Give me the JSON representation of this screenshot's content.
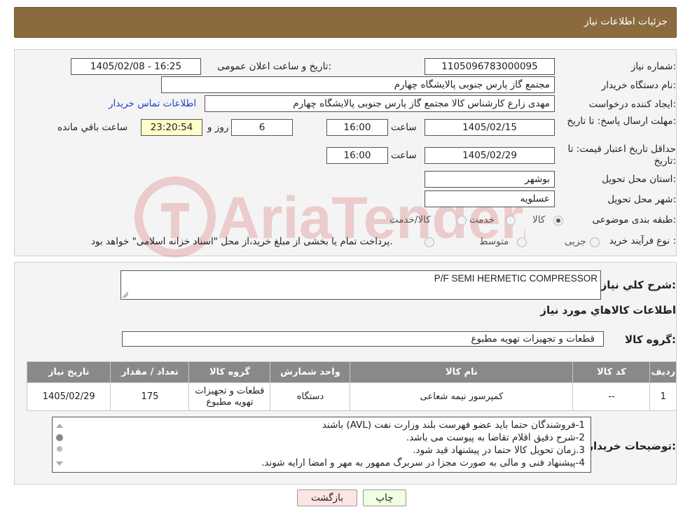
{
  "header": {
    "title": "جزئیات اطلاعات نیاز"
  },
  "need_number": {
    "label": "شماره نیاز:",
    "value": "1105096783000095"
  },
  "announce": {
    "label": "تاریخ و ساعت اعلان عمومی:",
    "value": "1405/02/08 - 16:25"
  },
  "buyer_org": {
    "label": "نام دستگاه خریدار:",
    "value": "مجتمع گاز پارس جنوبی  پالایشگاه چهارم"
  },
  "creator": {
    "label": "ایجاد کننده درخواست:",
    "value": "مهدی زارع کارشناس کالا مجتمع گاز پارس جنوبی  پالایشگاه چهارم",
    "contact_link": "اطلاعات تماس خریدار"
  },
  "deadline": {
    "label": "مهلت ارسال پاسخ: تا تاریخ:",
    "date": "1405/02/15",
    "time_label": "ساعت",
    "time": "16:00",
    "days": "6",
    "days_label": "روز و",
    "remaining": "23:20:54",
    "remaining_label": "ساعت باقي مانده"
  },
  "validity": {
    "label": "حداقل تاریخ اعتبار قیمت: تا تاریخ:",
    "date": "1405/02/29",
    "time_label": "ساعت",
    "time": "16:00"
  },
  "province": {
    "label": "استان محل تحویل:",
    "value": "بوشهر"
  },
  "city": {
    "label": "شهر محل تحویل:",
    "value": "عسلویه"
  },
  "category": {
    "label": "طبقه بندی موضوعی:",
    "options": [
      "کالا",
      "خدمت",
      "کالا/خدمت"
    ],
    "selected": 0
  },
  "process": {
    "label": "نوع فرآیند خرید :",
    "options": [
      "جزیی",
      "متوسط"
    ],
    "note": "پرداخت تمام یا بخشی از مبلغ خرید،از محل \"اسناد خزانه اسلامی\" خواهد بود."
  },
  "description": {
    "label": "شرح کلي نیاز:",
    "value": "P/F SEMI HERMETIC COMPRESSOR"
  },
  "items_section": {
    "title": "اطلاعات کالاهاي مورد نیاز"
  },
  "goods_group": {
    "label": "گروه کالا:",
    "value": "قطعات و تجهیزات تهویه مطبوع"
  },
  "table": {
    "headers": [
      "ردیف",
      "کد کالا",
      "نام کالا",
      "واحد شمارش",
      "گروه کالا",
      "تعداد / مقدار",
      "تاریخ نیاز"
    ],
    "rows": [
      [
        "1",
        "--",
        "کمپرسور نیمه شعاعی",
        "دستگاه",
        "قطعات و تجهیزات تهویه مطبوع",
        "175",
        "1405/02/29"
      ]
    ]
  },
  "notes": {
    "label": "توضیحات خریدار:",
    "lines": [
      "1-فروشندگان حتما باید عضو فهرست بلند وزارت نفت (AVL) باشند",
      "2-شرح دقیق اقلام تقاضا به پیوست می باشد.",
      "3.زمان تحویل کالا حتما در پیشنهاد قید شود.",
      "4-پیشنهاد فنی و مالی به صورت مجزا در سربرگ ممهور به مهر و امضا ارایه شوند."
    ]
  },
  "buttons": {
    "print": "چاپ",
    "back": "بازگشت"
  },
  "colors": {
    "header": "#8b6b3e",
    "table_header": "#898989",
    "remaining_bg": "#ffffcc",
    "print_bg": "#efffdf",
    "back_bg": "#ffe4e4",
    "link": "#1a44c6"
  }
}
